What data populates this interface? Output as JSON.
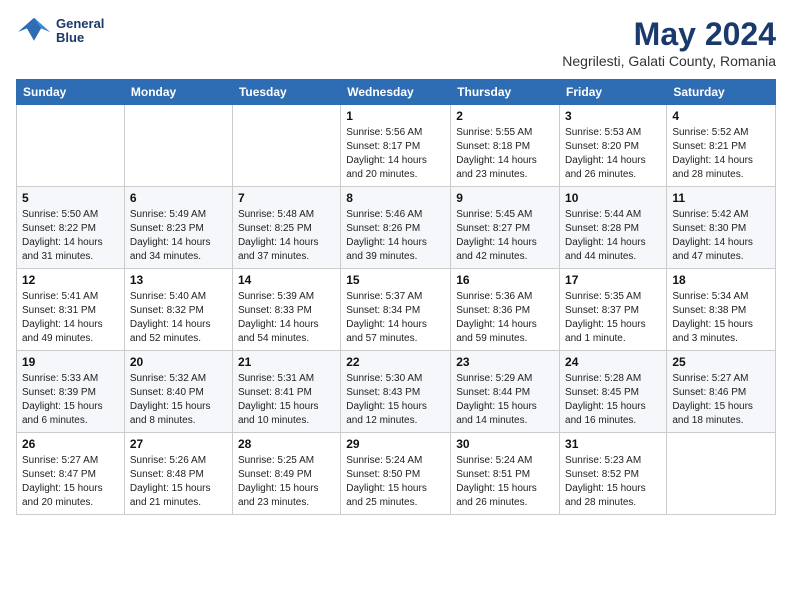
{
  "header": {
    "logo_line1": "General",
    "logo_line2": "Blue",
    "month": "May 2024",
    "location": "Negrilesti, Galati County, Romania"
  },
  "weekdays": [
    "Sunday",
    "Monday",
    "Tuesday",
    "Wednesday",
    "Thursday",
    "Friday",
    "Saturday"
  ],
  "weeks": [
    [
      {
        "day": "",
        "info": ""
      },
      {
        "day": "",
        "info": ""
      },
      {
        "day": "",
        "info": ""
      },
      {
        "day": "1",
        "info": "Sunrise: 5:56 AM\nSunset: 8:17 PM\nDaylight: 14 hours\nand 20 minutes."
      },
      {
        "day": "2",
        "info": "Sunrise: 5:55 AM\nSunset: 8:18 PM\nDaylight: 14 hours\nand 23 minutes."
      },
      {
        "day": "3",
        "info": "Sunrise: 5:53 AM\nSunset: 8:20 PM\nDaylight: 14 hours\nand 26 minutes."
      },
      {
        "day": "4",
        "info": "Sunrise: 5:52 AM\nSunset: 8:21 PM\nDaylight: 14 hours\nand 28 minutes."
      }
    ],
    [
      {
        "day": "5",
        "info": "Sunrise: 5:50 AM\nSunset: 8:22 PM\nDaylight: 14 hours\nand 31 minutes."
      },
      {
        "day": "6",
        "info": "Sunrise: 5:49 AM\nSunset: 8:23 PM\nDaylight: 14 hours\nand 34 minutes."
      },
      {
        "day": "7",
        "info": "Sunrise: 5:48 AM\nSunset: 8:25 PM\nDaylight: 14 hours\nand 37 minutes."
      },
      {
        "day": "8",
        "info": "Sunrise: 5:46 AM\nSunset: 8:26 PM\nDaylight: 14 hours\nand 39 minutes."
      },
      {
        "day": "9",
        "info": "Sunrise: 5:45 AM\nSunset: 8:27 PM\nDaylight: 14 hours\nand 42 minutes."
      },
      {
        "day": "10",
        "info": "Sunrise: 5:44 AM\nSunset: 8:28 PM\nDaylight: 14 hours\nand 44 minutes."
      },
      {
        "day": "11",
        "info": "Sunrise: 5:42 AM\nSunset: 8:30 PM\nDaylight: 14 hours\nand 47 minutes."
      }
    ],
    [
      {
        "day": "12",
        "info": "Sunrise: 5:41 AM\nSunset: 8:31 PM\nDaylight: 14 hours\nand 49 minutes."
      },
      {
        "day": "13",
        "info": "Sunrise: 5:40 AM\nSunset: 8:32 PM\nDaylight: 14 hours\nand 52 minutes."
      },
      {
        "day": "14",
        "info": "Sunrise: 5:39 AM\nSunset: 8:33 PM\nDaylight: 14 hours\nand 54 minutes."
      },
      {
        "day": "15",
        "info": "Sunrise: 5:37 AM\nSunset: 8:34 PM\nDaylight: 14 hours\nand 57 minutes."
      },
      {
        "day": "16",
        "info": "Sunrise: 5:36 AM\nSunset: 8:36 PM\nDaylight: 14 hours\nand 59 minutes."
      },
      {
        "day": "17",
        "info": "Sunrise: 5:35 AM\nSunset: 8:37 PM\nDaylight: 15 hours\nand 1 minute."
      },
      {
        "day": "18",
        "info": "Sunrise: 5:34 AM\nSunset: 8:38 PM\nDaylight: 15 hours\nand 3 minutes."
      }
    ],
    [
      {
        "day": "19",
        "info": "Sunrise: 5:33 AM\nSunset: 8:39 PM\nDaylight: 15 hours\nand 6 minutes."
      },
      {
        "day": "20",
        "info": "Sunrise: 5:32 AM\nSunset: 8:40 PM\nDaylight: 15 hours\nand 8 minutes."
      },
      {
        "day": "21",
        "info": "Sunrise: 5:31 AM\nSunset: 8:41 PM\nDaylight: 15 hours\nand 10 minutes."
      },
      {
        "day": "22",
        "info": "Sunrise: 5:30 AM\nSunset: 8:43 PM\nDaylight: 15 hours\nand 12 minutes."
      },
      {
        "day": "23",
        "info": "Sunrise: 5:29 AM\nSunset: 8:44 PM\nDaylight: 15 hours\nand 14 minutes."
      },
      {
        "day": "24",
        "info": "Sunrise: 5:28 AM\nSunset: 8:45 PM\nDaylight: 15 hours\nand 16 minutes."
      },
      {
        "day": "25",
        "info": "Sunrise: 5:27 AM\nSunset: 8:46 PM\nDaylight: 15 hours\nand 18 minutes."
      }
    ],
    [
      {
        "day": "26",
        "info": "Sunrise: 5:27 AM\nSunset: 8:47 PM\nDaylight: 15 hours\nand 20 minutes."
      },
      {
        "day": "27",
        "info": "Sunrise: 5:26 AM\nSunset: 8:48 PM\nDaylight: 15 hours\nand 21 minutes."
      },
      {
        "day": "28",
        "info": "Sunrise: 5:25 AM\nSunset: 8:49 PM\nDaylight: 15 hours\nand 23 minutes."
      },
      {
        "day": "29",
        "info": "Sunrise: 5:24 AM\nSunset: 8:50 PM\nDaylight: 15 hours\nand 25 minutes."
      },
      {
        "day": "30",
        "info": "Sunrise: 5:24 AM\nSunset: 8:51 PM\nDaylight: 15 hours\nand 26 minutes."
      },
      {
        "day": "31",
        "info": "Sunrise: 5:23 AM\nSunset: 8:52 PM\nDaylight: 15 hours\nand 28 minutes."
      },
      {
        "day": "",
        "info": ""
      }
    ]
  ]
}
